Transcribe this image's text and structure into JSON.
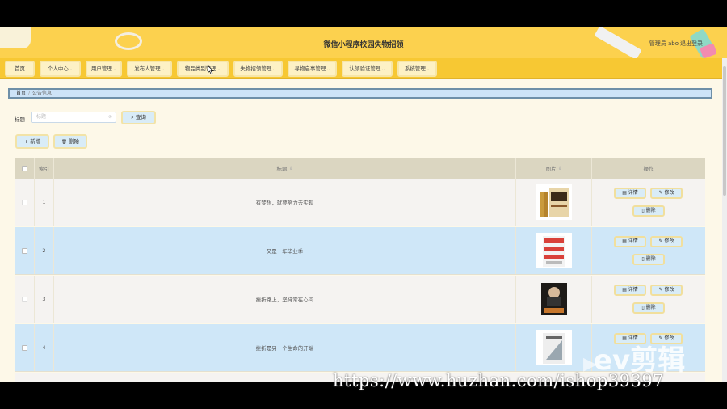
{
  "header": {
    "title": "微信小程序校园失物招领",
    "user_label": "管理员 abo",
    "logout_label": "退出登录"
  },
  "nav": {
    "items": [
      {
        "label": "首页",
        "has_menu": false
      },
      {
        "label": "个人中心",
        "has_menu": true
      },
      {
        "label": "用户管理",
        "has_menu": true
      },
      {
        "label": "发布人管理",
        "has_menu": true
      },
      {
        "label": "物品类别管理",
        "has_menu": true
      },
      {
        "label": "失物招领管理",
        "has_menu": true
      },
      {
        "label": "寻物启事管理",
        "has_menu": true
      },
      {
        "label": "认领验证管理",
        "has_menu": true
      },
      {
        "label": "系统管理",
        "has_menu": true
      }
    ],
    "chevron": "⌄"
  },
  "breadcrumb": {
    "home": "首页",
    "separator": "/",
    "current": "公告信息"
  },
  "search": {
    "label": "标题",
    "placeholder": "标题",
    "button_label": "查询",
    "clear_icon": "⊗",
    "search_icon": "⌕"
  },
  "toolbar": {
    "add_label": "新增",
    "add_icon": "+",
    "delete_label": "删除",
    "delete_icon": "🗑"
  },
  "table": {
    "headers": {
      "index": "索引",
      "title": "标题",
      "image": "图片",
      "actions": "操作",
      "sort_icon": "⇕"
    },
    "rows": [
      {
        "index": "1",
        "title": "有梦想，就要努力去实现"
      },
      {
        "index": "2",
        "title": "又是一年毕业季"
      },
      {
        "index": "3",
        "title": "挫折路上，坚持常在心间"
      },
      {
        "index": "4",
        "title": "挫折是另一个生命的开端"
      }
    ],
    "action_labels": {
      "detail": "详情",
      "edit": "修改",
      "delete": "删除"
    }
  },
  "overlay": {
    "watermark": "https://www.huzhan.com/ishop39397",
    "ev_logo": "ev剪辑"
  },
  "colors": {
    "header_bg": "#fcd14e",
    "nav_bg": "#f7c833",
    "row_highlight": "#cfe7f8",
    "button_bg": "#d9ecf7"
  }
}
